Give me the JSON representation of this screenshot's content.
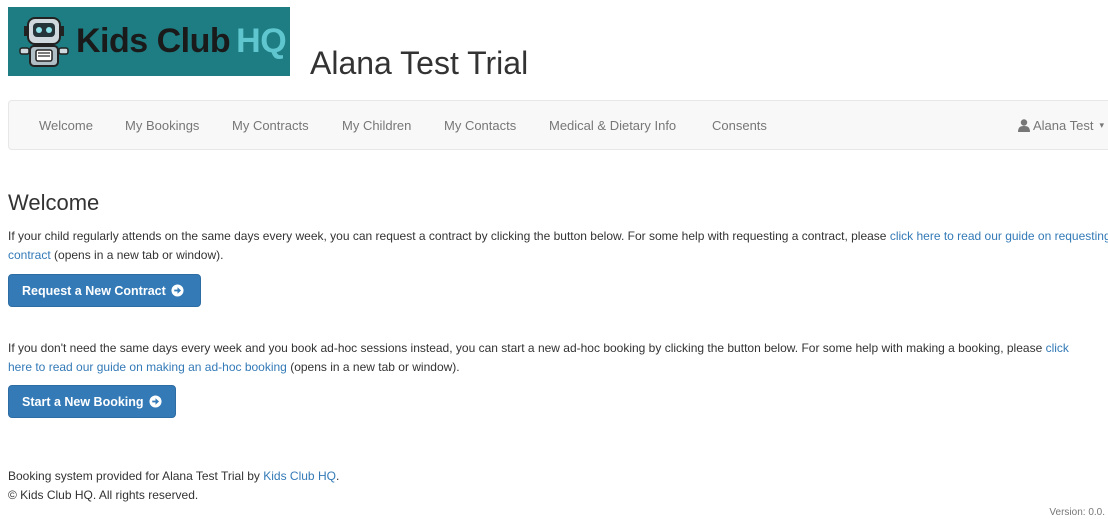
{
  "logo": {
    "kids": "Kids Club",
    "hq": "HQ"
  },
  "site_title": "Alana Test Trial",
  "nav": {
    "items": [
      "Welcome",
      "My Bookings",
      "My Contracts",
      "My Children",
      "My Contacts",
      "Medical & Dietary Info",
      "Consents"
    ],
    "user": "Alana Test"
  },
  "main": {
    "heading": "Welcome",
    "p1_text": "If your child regularly attends on the same days every week, you can request a contract by clicking the button below. For some help with requesting a contract, please ",
    "p1_link": "click here to read our guide on requesting a contract",
    "p1_tail": " (opens in a new tab or window).",
    "btn_contract": "Request a New Contract",
    "p2_text": "If you don't need the same days every week and you book ad-hoc sessions instead, you can start a new ad-hoc booking by clicking the button below. For some help with making a booking, please ",
    "p2_link": "click here to read our guide on making an ad-hoc booking",
    "p2_tail": " (opens in a new tab or window).",
    "btn_booking": "Start a New Booking"
  },
  "footer": {
    "line1_text": "Booking system provided for Alana Test Trial by ",
    "line1_link": "Kids Club HQ",
    "line1_tail": ".",
    "line2": "© Kids Club HQ. All rights reserved."
  },
  "version": "Version: 0.0.",
  "colors": {
    "brand_teal": "#1e7d82",
    "primary": "#337ab7",
    "logo_hq": "#5fc6cf"
  }
}
